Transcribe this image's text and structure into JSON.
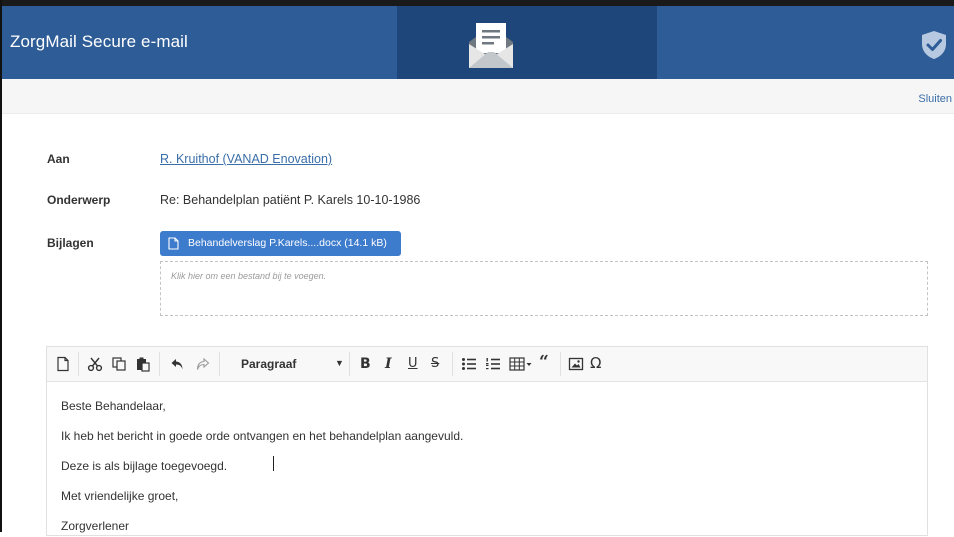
{
  "header": {
    "app_title": "ZorgMail Secure e-mail",
    "logo_icon": "envelope-document-icon",
    "shield_icon": "shield-check-icon",
    "colors": {
      "header_bg": "#2d5c97",
      "header_center_bg": "#1f467a",
      "accent": "#3d7bcc"
    }
  },
  "subbar": {
    "close_label": "Sluiten"
  },
  "message": {
    "to_label": "Aan",
    "to_value": "R. Kruithof (VANAD Enovation)",
    "subject_label": "Onderwerp",
    "subject_value": "Re: Behandelplan patiënt P. Karels 10-10-1986",
    "attachments_label": "Bijlagen",
    "attachment": "Behandelverslag P.Karels....docx (14.1 kB)",
    "dropzone_text": "Klik hier om een bestand bij te voegen."
  },
  "toolbar": {
    "format_label": "Paragraaf",
    "icons": [
      "new-document-icon",
      "cut-icon",
      "copy-icon",
      "paste-icon",
      "undo-icon",
      "redo-icon",
      "bold-icon",
      "italic-icon",
      "underline-icon",
      "strikethrough-icon",
      "bullet-list-icon",
      "numbered-list-icon",
      "table-icon",
      "quote-icon",
      "image-icon",
      "special-character-icon"
    ]
  },
  "editor": {
    "lines": [
      "Beste Behandelaar,",
      "Ik heb het bericht in goede orde ontvangen en het behandelplan aangevuld.",
      "Deze is als bijlage toegevoegd.",
      "Met vriendelijke groet,",
      "Zorgverlener"
    ]
  }
}
